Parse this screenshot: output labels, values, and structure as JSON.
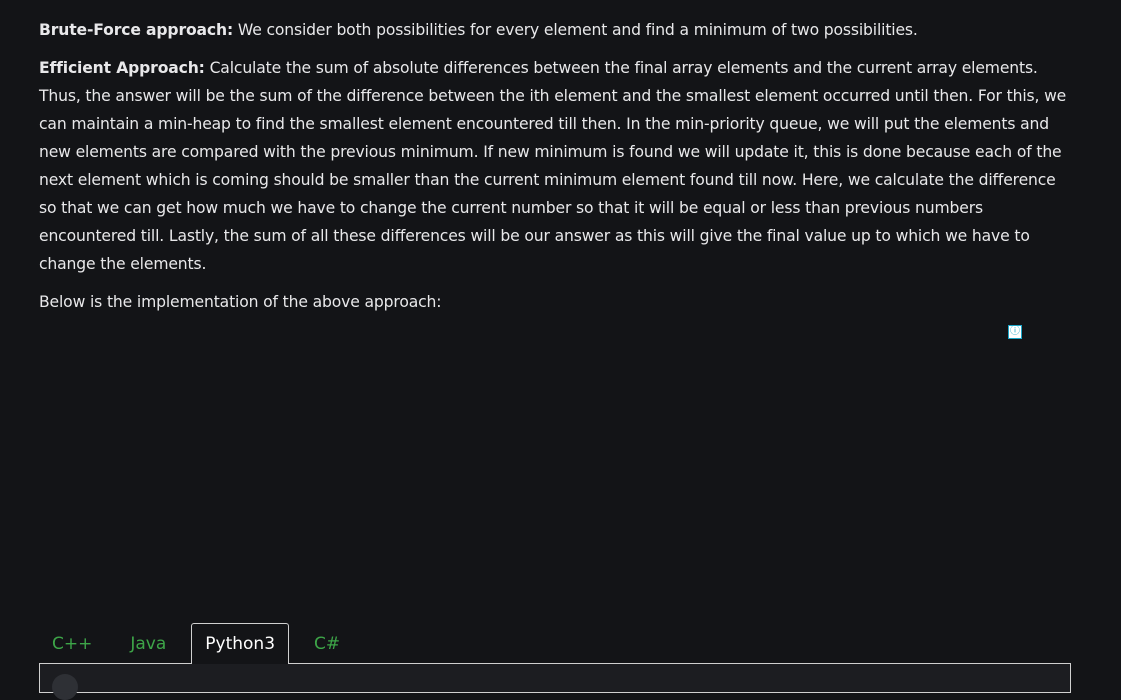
{
  "article": {
    "brute_force": {
      "label": "Brute-Force approach:",
      "text": " We consider both possibilities for every element and find a minimum of two possibilities."
    },
    "efficient": {
      "label": "Efficient Approach:",
      "text": " Calculate the sum of absolute differences between the final array elements and the current array elements. Thus, the answer will be the sum of the difference between the ith element and the smallest element occurred until then. For this, we can maintain a min-heap to find the smallest element encountered till then. In the min-priority queue, we will put the elements and new elements are compared with the previous minimum. If new minimum is found we will update it, this is done because each of the next element which is coming should be smaller than the current minimum element found till now. Here, we calculate the difference so that we can get how much we have to change the current number so that it will be equal or less than previous numbers encountered till. Lastly, the sum of all these differences will be our answer as this will give the final value up to which we have to change the elements."
    },
    "implementation_intro": "Below is the implementation of the above approach:"
  },
  "ad": {
    "info_glyph": "ⓘ",
    "icon": "info-icon"
  },
  "code_tabs": {
    "items": [
      {
        "label": "C++"
      },
      {
        "label": "Java"
      },
      {
        "label": "Python3"
      },
      {
        "label": "C#"
      }
    ],
    "active": "Python3"
  },
  "colors": {
    "background": "#131417",
    "text": "#e8e8ea",
    "tab_inactive": "#3da548",
    "tab_active": "#ffffff",
    "ad_icon": "#1aa6c8"
  }
}
